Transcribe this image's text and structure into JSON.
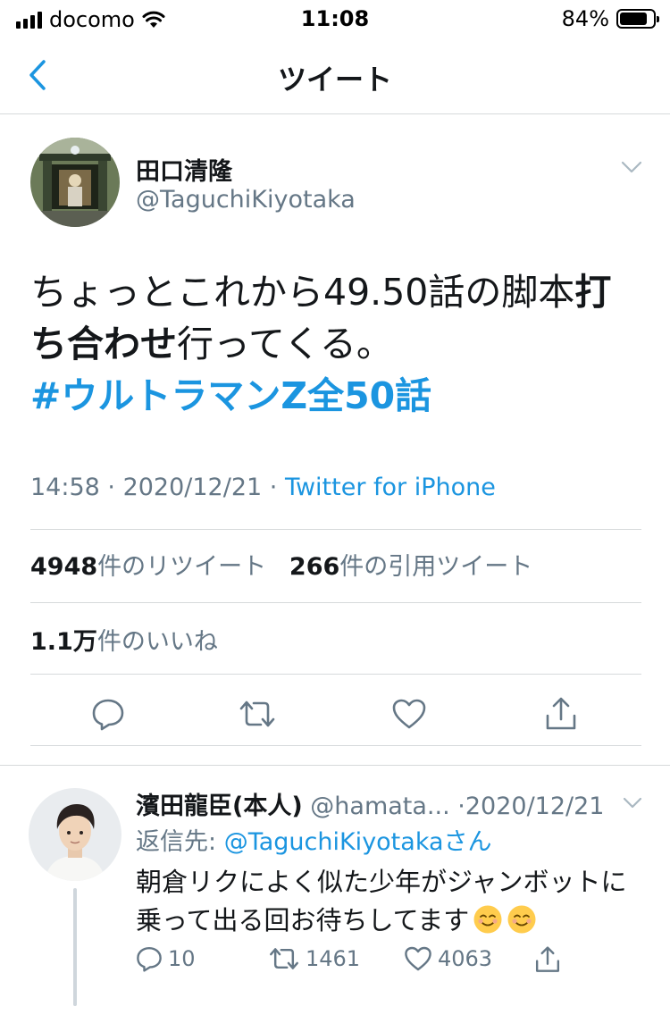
{
  "status_bar": {
    "carrier": "docomo",
    "time": "11:08",
    "battery_percent": "84%",
    "battery_level": 0.84
  },
  "nav": {
    "title": "ツイート",
    "back_icon": "chevron-left-icon"
  },
  "tweet": {
    "author_name": "田口清隆",
    "author_handle": "@TaguchiKiyotaka",
    "text_part1": "ちょっとこれから49.50話の脚本",
    "text_bold1": "打",
    "text_bold2": "ち合わせ",
    "text_part2": "行ってくる。",
    "hashtag": "#ウルトラマンZ全50話",
    "time": "14:58",
    "date": "2020/12/21",
    "source": "Twitter for iPhone",
    "retweets_count": "4948",
    "retweets_label": "件のリツイート",
    "quotes_count": "266",
    "quotes_label": "件の引用ツイート",
    "likes_count": "1.1万",
    "likes_label": "件のいいね",
    "accent_color": "#1b95e0"
  },
  "reply": {
    "name": "濱田龍臣(本人)",
    "handle": "@hamata...",
    "date": "2020/12/21",
    "reply_to_prefix": "返信先:",
    "reply_to_mention": "@TaguchiKiyotakaさん",
    "text": "朝倉リクによく似た少年がジャンボットに乗って出る回お待ちしてます",
    "replies": "10",
    "retweets": "1461",
    "likes": "4063"
  }
}
